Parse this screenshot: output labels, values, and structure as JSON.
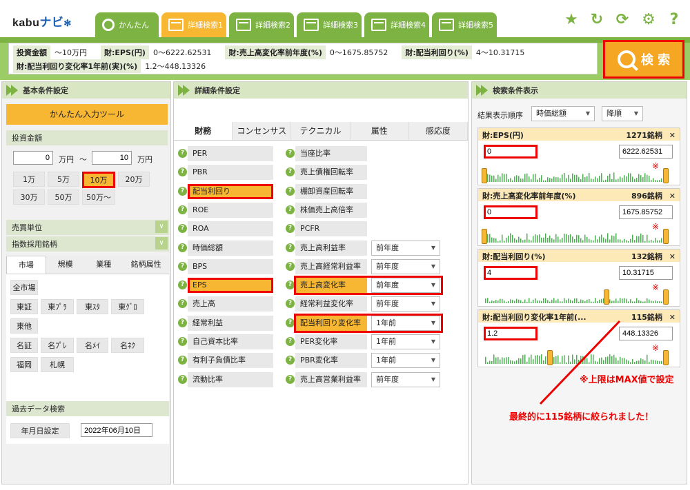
{
  "header": {
    "logo_text": "kabu",
    "logo_nav": "ナビ",
    "tabs": [
      "かんたん",
      "詳細検索1",
      "詳細検索2",
      "詳細検索3",
      "詳細検索4",
      "詳細検索5"
    ],
    "icons": [
      "star-icon",
      "refresh-icon",
      "sync-icon",
      "gear-icon",
      "help-icon"
    ]
  },
  "summary": {
    "rows": [
      [
        {
          "label": "投資金額",
          "value": "～10万円"
        },
        {
          "label": "財:EPS(円)",
          "value": "0～6222.62531"
        },
        {
          "label": "財:売上高変化率前年度(%)",
          "value": "0～1675.85752"
        },
        {
          "label": "財:配当利回り(%)",
          "value": "4～10.31715"
        }
      ],
      [
        {
          "label": "財:配当利回り変化率1年前(実)(%)",
          "value": "1.2～448.13326"
        }
      ]
    ],
    "search_label": "検 索"
  },
  "left": {
    "title": "基本条件設定",
    "easy_tool": "かんたん入力ツール",
    "invest_label": "投資金額",
    "min_value": "0",
    "max_value": "10",
    "unit": "万円",
    "tilde": "～",
    "amounts": [
      "1万",
      "5万",
      "10万",
      "20万",
      "30万",
      "50万",
      "50万～"
    ],
    "trade_unit": "売買単位",
    "index": "指数採用銘柄",
    "subtabs": [
      "市場",
      "規模",
      "業種",
      "銘柄属性"
    ],
    "markets": [
      "全市場",
      "東証",
      "東ﾌﾟﾗ",
      "東ｽﾀ",
      "東ｸﾞﾛ",
      "東他",
      "名証",
      "名ﾌﾟﾚ",
      "名ﾒｲ",
      "名ﾈｸ",
      "福岡",
      "札幌"
    ],
    "history": "過去データ検索",
    "date_btn": "年月日設定",
    "date_value": "2022年06月10日"
  },
  "mid": {
    "title": "詳細条件設定",
    "tabs": [
      "財務",
      "コンセンサス",
      "テクニカル",
      "属性",
      "感応度"
    ],
    "col1": [
      "PER",
      "PBR",
      "配当利回り",
      "ROE",
      "ROA",
      "時価総額",
      "BPS",
      "EPS",
      "売上高",
      "経常利益",
      "自己資本比率",
      "有利子負債比率",
      "流動比率"
    ],
    "col2": [
      "当座比率",
      "売上債権回転率",
      "棚卸資産回転率",
      "株価売上高倍率",
      "PCFR",
      "売上高利益率",
      "売上高経常利益率",
      "売上高変化率",
      "経常利益変化率",
      "配当利回り変化率",
      "PER変化率",
      "PBR変化率",
      "売上高営業利益率"
    ],
    "dropdowns": [
      "前年度",
      "前年度",
      "前年度",
      "前年度",
      "1年前",
      "1年前",
      "1年前",
      "前年度"
    ]
  },
  "right": {
    "title": "検索条件表示",
    "order_label": "結果表示順序",
    "order_value": "時価総額",
    "dir_value": "降順",
    "cards": [
      {
        "title": "財:EPS(円)",
        "count": "1271銘柄",
        "min": "0",
        "max": "6222.62531"
      },
      {
        "title": "財:売上高変化率前年度(%)",
        "count": "896銘柄",
        "min": "0",
        "max": "1675.85752"
      },
      {
        "title": "財:配当利回り(%)",
        "count": "132銘柄",
        "min": "4",
        "max": "10.31715"
      },
      {
        "title": "財:配当利回り変化率1年前(...",
        "count": "115銘柄",
        "min": "1.2",
        "max": "448.13326"
      }
    ],
    "close": "✕",
    "mark": "※",
    "note_max": "※上限はMAX値で設定",
    "note_result": "最終的に115銘柄に絞られました！"
  },
  "colors": {
    "green": "#7cb342",
    "orange": "#f7b733",
    "red": "#e00000"
  }
}
